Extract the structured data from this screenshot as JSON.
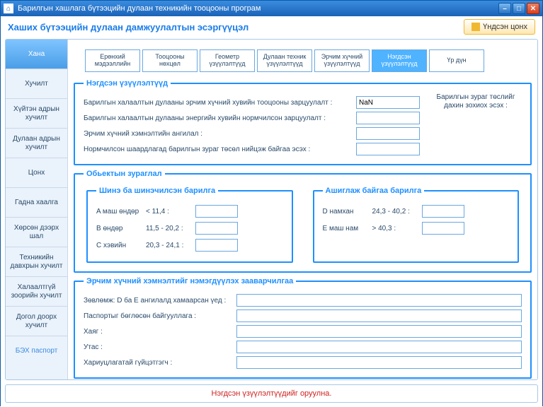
{
  "titlebar": {
    "title": "Барилгын хашлага бүтээцийн дулаан техникийн тооцооны програм"
  },
  "header": {
    "title": "Хаших бүтээцийн дулаан дамжуулалтын эсэргүүцэл",
    "main_button": "Үндсэн цонх"
  },
  "sidebar": {
    "items": [
      {
        "label": "Хана",
        "selected": true
      },
      {
        "label": "Хучилт"
      },
      {
        "label": "Хүйтэн адрын хучилт"
      },
      {
        "label": "Дулаан адрын хучилт"
      },
      {
        "label": "Цонх"
      },
      {
        "label": "Гадна хаалга"
      },
      {
        "label": "Хөрсөн дээрх шал"
      },
      {
        "label": "Техникийн давхрын хучилт"
      },
      {
        "label": "Халаалтгүй зоорийн хучилт"
      },
      {
        "label": "Догол доорх хучилт"
      },
      {
        "label": "БЭХ паспорт",
        "flat": true
      }
    ]
  },
  "tabs": {
    "items": [
      {
        "label": "Ерөнхий мэдээллийн"
      },
      {
        "label": "Тооцооны нөхцөл"
      },
      {
        "label": "Геометр үзүүлэлтүүд"
      },
      {
        "label": "Дулаан техник үзүүлэлтүүд"
      },
      {
        "label": "Эрчим хүчний үзүүлэлтүүд"
      },
      {
        "label": "Нэгдсэн үзүүлэлтүүд",
        "active": true
      },
      {
        "label": "Үр дүн"
      }
    ]
  },
  "group1": {
    "legend": "Нэгдсэн  үзүүлэлтүүд",
    "rows": [
      {
        "label": "Барилгын халаалтын дулааны эрчим хүчний хувийн тооцооны зарцуулалт :",
        "value": "NaN"
      },
      {
        "label": "Барилгын халаалтын дулааны энергийн хувийн нормчилсон  зарцуулалт :",
        "value": ""
      },
      {
        "label": "Эрчим хүчний хэмнэлтийн ангилал :",
        "value": ""
      },
      {
        "label": "Нормчилсон шаардлагад барилгын зураг төсөл нийцэж  байгаа эсэх :",
        "value": ""
      }
    ],
    "side": "Барилгын зураг төслийг дахин зохиох эсэх :"
  },
  "group2": {
    "legend": "Обьектын зураглал",
    "left": {
      "legend": "Шинэ ба шинэчилсэн барилга",
      "rows": [
        {
          "c": "A  маш өндөр",
          "r": "< 11,4 :"
        },
        {
          "c": "B  өндөр",
          "r": "11,5 - 20,2 :"
        },
        {
          "c": "C  хэвийн",
          "r": "20,3 - 24,1 :"
        }
      ]
    },
    "right": {
      "legend": "Ашиглаж байгаа барилга",
      "rows": [
        {
          "c": "D  намхан",
          "r": "24,3 - 40,2 :"
        },
        {
          "c": "E  маш нам",
          "r": "> 40,3 :"
        }
      ]
    }
  },
  "group3": {
    "legend": "Эрчим хүчний хэмнэлтийг нэмэгдүүлэх зааварчилгаа",
    "rows": [
      {
        "label": "Зөвлөмж: D ба E ангилалд хамаарсан үед :"
      },
      {
        "label": "Паспортыг бөглөсөн байгууллага :"
      },
      {
        "label": "Хаяг :"
      },
      {
        "label": "Утас :"
      },
      {
        "label": "Хариуцлагатай гүйцэтгэгч :"
      }
    ]
  },
  "footer": {
    "msg": "Нэгдсэн үзүүлэлтүүдийг оруулна."
  }
}
